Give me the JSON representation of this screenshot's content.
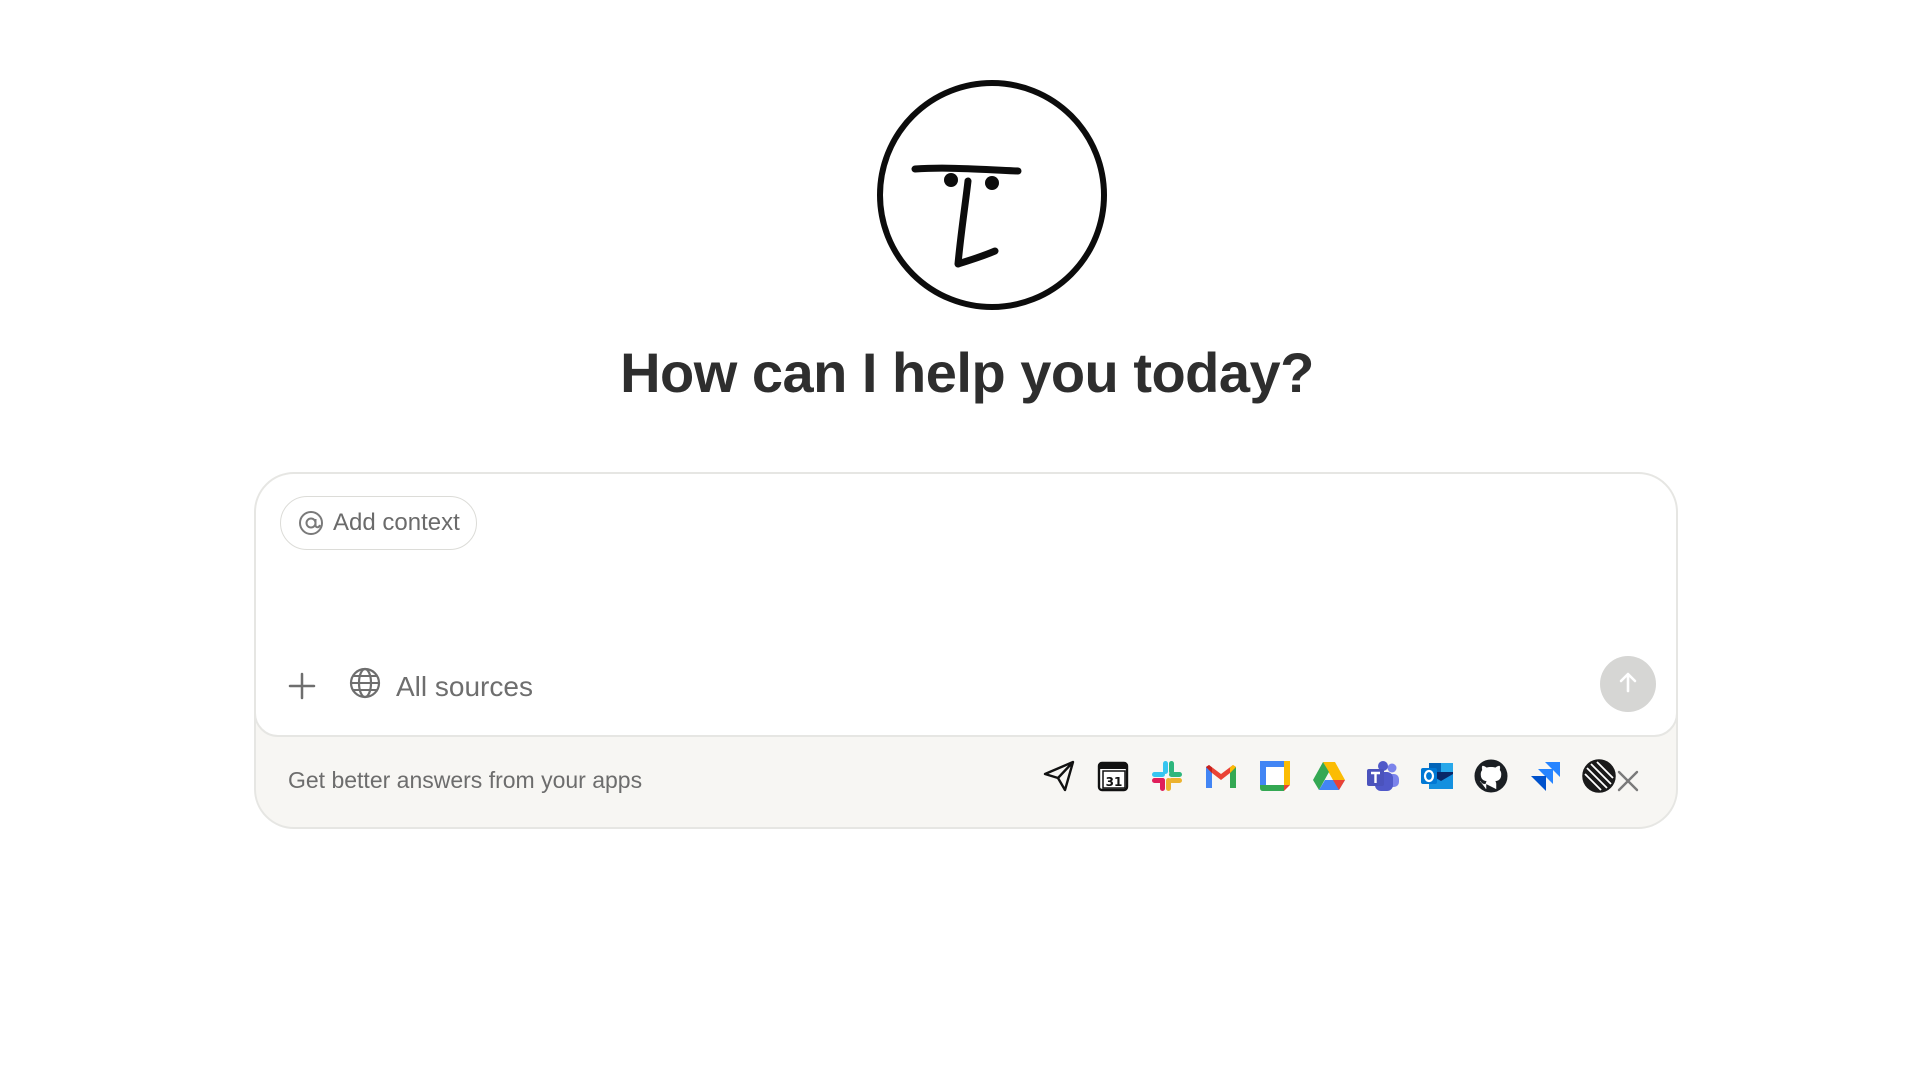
{
  "logo": {
    "icon": "notion-ai-face-icon"
  },
  "headline": "How can I help you today?",
  "composer": {
    "context_chip_label": "Add context",
    "context_chip_icon": "at-sign-icon",
    "add_icon": "plus-icon",
    "sources_label": "All sources",
    "sources_icon": "globe-icon",
    "send_icon": "arrow-up-icon",
    "send_disabled_color": "#d6d6d4"
  },
  "apps_bar": {
    "text": "Get better answers from your apps",
    "apps": [
      "send-icon",
      "notion-calendar-icon",
      "slack-icon",
      "gmail-icon",
      "google-calendar-icon",
      "google-drive-icon",
      "microsoft-teams-icon",
      "outlook-icon",
      "github-icon",
      "jira-icon",
      "linear-icon"
    ],
    "close_icon": "close-icon",
    "background": "#f7f6f3"
  }
}
